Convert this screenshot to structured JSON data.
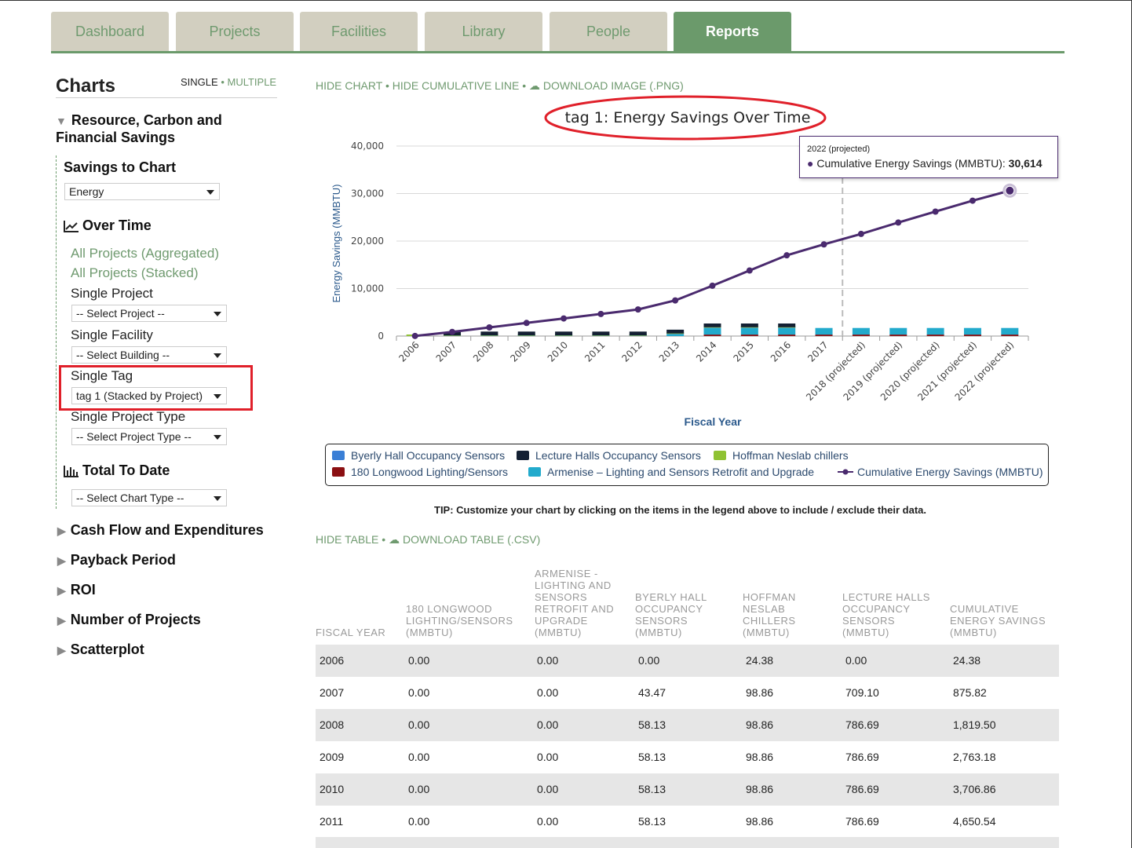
{
  "nav": {
    "tabs": [
      "Dashboard",
      "Projects",
      "Facilities",
      "Library",
      "People",
      "Reports"
    ],
    "active": "Reports"
  },
  "sidebar": {
    "title": "Charts",
    "mode_single": "SINGLE",
    "mode_multiple": "MULTIPLE",
    "section_title": "Resource, Carbon and Financial Savings",
    "savings_label": "Savings to Chart",
    "savings_value": "Energy",
    "over_time": "Over Time",
    "all_agg": "All Projects (Aggregated)",
    "all_stacked": "All Projects (Stacked)",
    "single_project": "Single Project",
    "select_project": "-- Select Project --",
    "single_facility": "Single Facility",
    "select_building": "-- Select Building --",
    "single_tag": "Single Tag",
    "tag_value": "tag 1 (Stacked by Project)",
    "single_project_type": "Single Project Type",
    "select_project_type": "-- Select Project Type --",
    "total_to_date": "Total To Date",
    "select_chart_type": "-- Select Chart Type --",
    "collapsed": [
      "Cash Flow and Expenditures",
      "Payback Period",
      "ROI",
      "Number of Projects",
      "Scatterplot"
    ]
  },
  "actions": {
    "hide_chart": "HIDE CHART",
    "hide_cumulative": "HIDE CUMULATIVE LINE",
    "download_image": "DOWNLOAD IMAGE (.PNG)"
  },
  "tooltip": {
    "header": "2022 (projected)",
    "series": "Cumulative Energy Savings (MMBTU):",
    "value": "30,614"
  },
  "chart_data": {
    "type": "bar",
    "title": "tag 1: Energy Savings Over Time",
    "xlabel": "Fiscal Year",
    "ylabel": "Energy Savings (MMBTU)",
    "ylim": [
      0,
      40000
    ],
    "yticks": [
      "0",
      "10,000",
      "20,000",
      "30,000",
      "40,000"
    ],
    "categories": [
      "2006",
      "2007",
      "2008",
      "2009",
      "2010",
      "2011",
      "2012",
      "2013",
      "2014",
      "2015",
      "2016",
      "2017",
      "2018 (projected)",
      "2019 (projected)",
      "2020 (projected)",
      "2021 (projected)",
      "2022 (projected)"
    ],
    "stacked": true,
    "series": [
      {
        "name": "180 Longwood Lighting/Sensors",
        "color": "#8b0f12",
        "values": [
          0,
          0,
          0,
          0,
          0,
          0,
          0,
          0,
          300,
          300,
          300,
          300,
          300,
          300,
          300,
          300,
          300
        ]
      },
      {
        "name": "Armenise – Lighting and Sensors Retrofit and Upgrade",
        "color": "#22aacc",
        "values": [
          0,
          0,
          0,
          0,
          0,
          0,
          0,
          400,
          1400,
          1400,
          1400,
          1400,
          1400,
          1400,
          1400,
          1400,
          1400
        ]
      },
      {
        "name": "Byerly Hall Occupancy Sensors",
        "color": "#3a7fd6",
        "values": [
          0,
          43.47,
          58.13,
          58.13,
          58.13,
          58.13,
          58.13,
          58.13,
          58.13,
          58.13,
          58.13,
          0,
          0,
          0,
          0,
          0,
          0
        ]
      },
      {
        "name": "Hoffman Neslab chillers",
        "color": "#8fc232",
        "values": [
          24.38,
          98.86,
          98.86,
          98.86,
          98.86,
          98.86,
          98.86,
          98.86,
          98.86,
          98.86,
          98.86,
          0,
          0,
          0,
          0,
          0,
          0
        ]
      },
      {
        "name": "Lecture Halls Occupancy Sensors",
        "color": "#142033",
        "values": [
          0,
          709.1,
          786.69,
          786.69,
          786.69,
          786.69,
          786.69,
          786.69,
          786.69,
          786.69,
          786.69,
          0,
          0,
          0,
          0,
          0,
          0
        ]
      }
    ],
    "line": {
      "name": "Cumulative Energy Savings (MMBTU)",
      "color": "#4a2a6e",
      "values": [
        24.38,
        875.82,
        1819.5,
        2763.18,
        3706.86,
        4650.54,
        5600,
        7500,
        10600,
        13800,
        17000,
        19300,
        21500,
        23900,
        26200,
        28500,
        30614
      ]
    },
    "projected_from": "2018 (projected)",
    "legend_position": "bottom"
  },
  "tip_text": "TIP: Customize your chart by clicking on the items in the legend above to include / exclude their data.",
  "table_actions": {
    "hide_table": "HIDE TABLE",
    "download_table": "DOWNLOAD TABLE (.CSV)"
  },
  "table": {
    "headers": [
      [
        "FISCAL YEAR"
      ],
      [
        "180 LONGWOOD",
        "LIGHTING/SENSORS",
        "(MMBTU)"
      ],
      [
        "ARMENISE -",
        "LIGHTING AND",
        "SENSORS",
        "RETROFIT AND",
        "UPGRADE",
        "(MMBTU)"
      ],
      [
        "BYERLY HALL",
        "OCCUPANCY",
        "SENSORS",
        "(MMBTU)"
      ],
      [
        "HOFFMAN",
        "NESLAB",
        "CHILLERS",
        "(MMBTU)"
      ],
      [
        "LECTURE HALLS",
        "OCCUPANCY",
        "SENSORS",
        "(MMBTU)"
      ],
      [
        "CUMULATIVE",
        "ENERGY SAVINGS",
        "(MMBTU)"
      ]
    ],
    "rows": [
      [
        "2006",
        "0.00",
        "0.00",
        "0.00",
        "24.38",
        "0.00",
        "24.38"
      ],
      [
        "2007",
        "0.00",
        "0.00",
        "43.47",
        "98.86",
        "709.10",
        "875.82"
      ],
      [
        "2008",
        "0.00",
        "0.00",
        "58.13",
        "98.86",
        "786.69",
        "1,819.50"
      ],
      [
        "2009",
        "0.00",
        "0.00",
        "58.13",
        "98.86",
        "786.69",
        "2,763.18"
      ],
      [
        "2010",
        "0.00",
        "0.00",
        "58.13",
        "98.86",
        "786.69",
        "3,706.86"
      ],
      [
        "2011",
        "0.00",
        "0.00",
        "58.13",
        "98.86",
        "786.69",
        "4,650.54"
      ]
    ]
  }
}
